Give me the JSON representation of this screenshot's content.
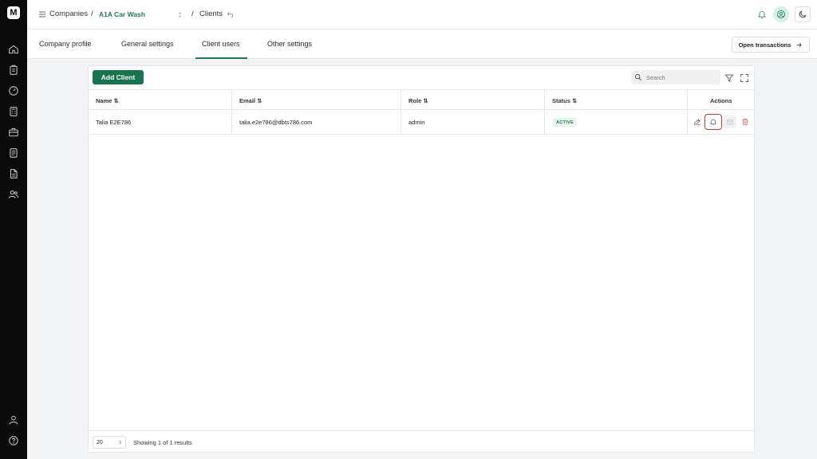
{
  "sidebar": {
    "logo_text": "M",
    "items": [
      {
        "icon": "home-icon"
      },
      {
        "icon": "clipboard-icon"
      },
      {
        "icon": "dashboard-gauge-icon"
      },
      {
        "icon": "calculator-icon"
      },
      {
        "icon": "briefcase-icon"
      },
      {
        "icon": "document-icon"
      },
      {
        "icon": "report-icon"
      },
      {
        "icon": "users-icon"
      }
    ],
    "bottom_items": [
      {
        "icon": "user-profile-icon"
      },
      {
        "icon": "help-icon"
      }
    ]
  },
  "topbar": {
    "breadcrumb": {
      "root": "Companies",
      "separator": "/",
      "company": "A1A Car Wash",
      "current": "Clients"
    },
    "accent_color": "#167a54"
  },
  "tabs": [
    {
      "label": "Company profile",
      "active": false
    },
    {
      "label": "General settings",
      "active": false
    },
    {
      "label": "Client users",
      "active": true
    },
    {
      "label": "Other settings",
      "active": false
    }
  ],
  "open_transactions_label": "Open transactions",
  "card": {
    "add_button_label": "Add Client",
    "search_placeholder": "Search",
    "columns": {
      "name": "Name",
      "email": "Email",
      "role": "Role",
      "status": "Status",
      "actions": "Actions"
    },
    "rows": [
      {
        "name": "Talia E2E786",
        "email": "talia.e2e786@dbts786.com",
        "role": "admin",
        "status": "ACTIVE"
      }
    ],
    "page_size": "20",
    "showing_text": "Showing 1 of 1 results"
  }
}
